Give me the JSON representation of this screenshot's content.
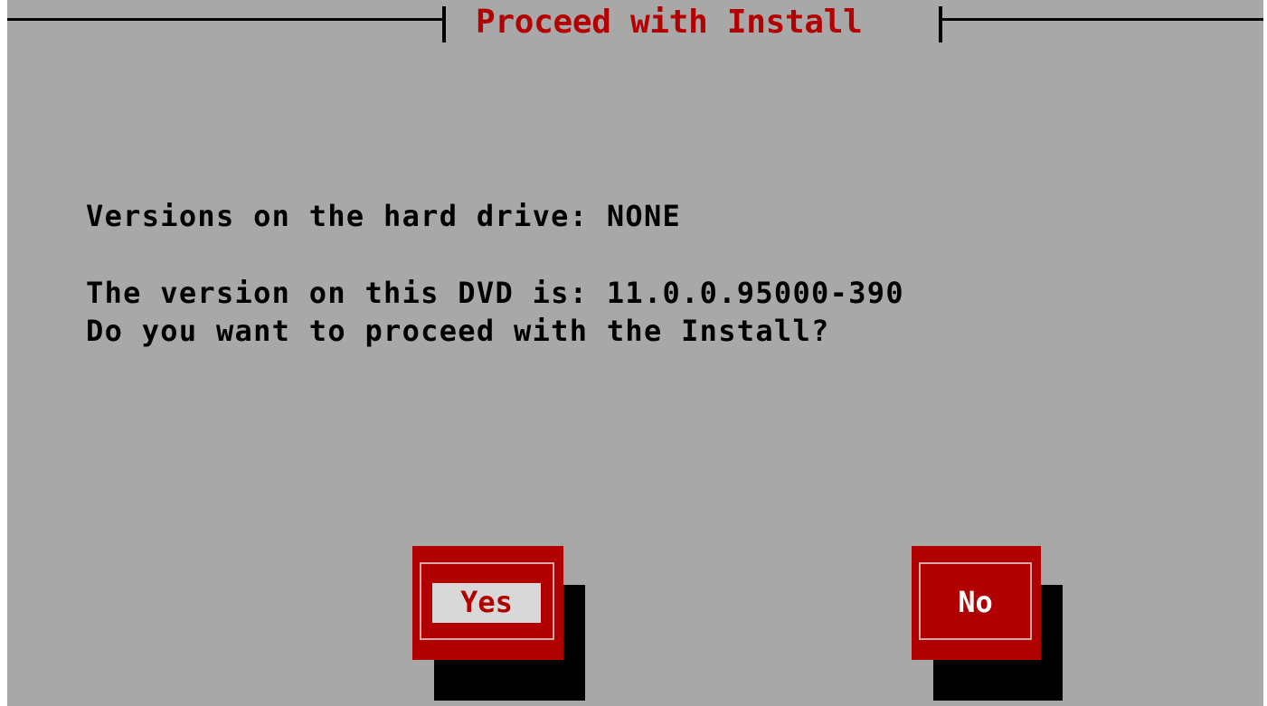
{
  "dialog": {
    "title": "Proceed with Install",
    "lines": [
      "Versions on the hard drive: NONE",
      "The version on this DVD is: 11.0.0.95000-390",
      "Do you want to proceed with the Install?"
    ]
  },
  "buttons": {
    "yes": "Yes",
    "no": "No",
    "focused": "yes"
  },
  "colors": {
    "background": "#a8a8a8",
    "accent": "#b00000",
    "text": "#000000"
  }
}
